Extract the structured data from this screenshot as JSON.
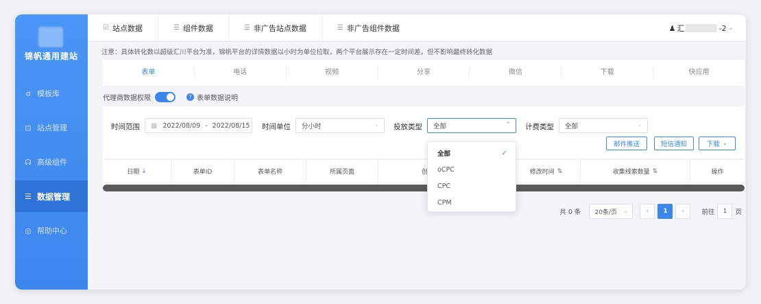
{
  "sidebar": {
    "brand": "锦帆通用建站",
    "items": [
      {
        "icon": "ơ",
        "icon_name": "template-icon",
        "label": "模板库"
      },
      {
        "icon": "⊡",
        "icon_name": "monitor-icon",
        "label": "站点管理"
      },
      {
        "icon": "☊",
        "icon_name": "component-icon",
        "label": "高级组件"
      },
      {
        "icon": "☰",
        "icon_name": "list-icon",
        "label": "数据管理"
      },
      {
        "icon": "◎",
        "icon_name": "help-icon",
        "label": "帮助中心"
      }
    ]
  },
  "topbar": {
    "tabs": [
      {
        "icon": "☑",
        "label": "站点数据"
      },
      {
        "icon": "☰",
        "label": "组件数据"
      },
      {
        "icon": "☰",
        "label": "非广告站点数据"
      },
      {
        "icon": "☰",
        "label": "非广告组件数据"
      }
    ],
    "user_prefix": "汇",
    "user_suffix": "-2"
  },
  "notice": "注意：具体转化数以超级汇川平台为准，锦帆平台的详情数据以小时为单位拉取，两个平台展示存在一定时间差，但不影响最终转化数据",
  "subtabs": [
    "表单",
    "电话",
    "视频",
    "分享",
    "微信",
    "下载",
    "快应用"
  ],
  "perm": {
    "label": "代理商数据权限",
    "help": "表单数据说明"
  },
  "filter": {
    "time_range_label": "时间范围",
    "date_start": "2022/08/09",
    "date_sep": "-",
    "date_end": "2022/08/15",
    "time_unit_label": "时间单位",
    "time_unit_value": "分小时",
    "delivery_label": "投放类型",
    "delivery_value": "全部",
    "billing_label": "计费类型",
    "billing_value": "全部",
    "btn_email": "邮件推送",
    "btn_sms": "短信通知",
    "btn_download": "下载"
  },
  "table": {
    "headers": [
      "日期",
      "表单ID",
      "表单名称",
      "所属页面",
      "创建时",
      "",
      "修改时间",
      "收集线索数量",
      "操作"
    ]
  },
  "pager": {
    "total": "共 0 条",
    "size": "20条/页",
    "current": "1",
    "goto_label": "前往",
    "goto_value": "1",
    "page_suffix": "页"
  },
  "dropdown": {
    "options": [
      "全部",
      "oCPC",
      "CPC",
      "CPM"
    ],
    "selected": "全部"
  },
  "colors": {
    "accent": "#3d86ee",
    "sidebar": "#4a95f5"
  }
}
